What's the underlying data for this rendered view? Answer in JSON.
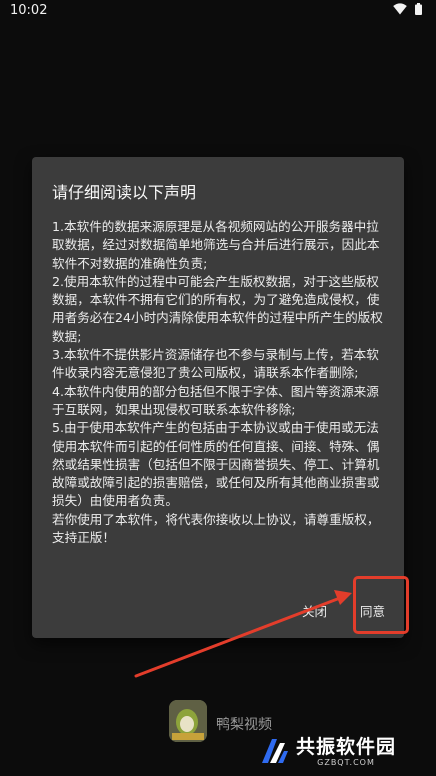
{
  "status_bar": {
    "time": "10:02"
  },
  "dialog": {
    "title": "请仔细阅读以下声明",
    "body": "1.本软件的数据来源原理是从各视频网站的公开服务器中拉取数据，经过对数据简单地筛选与合并后进行展示，因此本软件不对数据的准确性负责;\n2.使用本软件的过程中可能会产生版权数据，对于这些版权数据，本软件不拥有它们的所有权，为了避免造成侵权，使用者务必在24小时内清除使用本软件的过程中所产生的版权数据;\n3.本软件不提供影片资源储存也不参与录制与上传，若本软件收录内容无意侵犯了贵公司版权，请联系本作者删除;\n4.本软件内使用的部分包括但不限于字体、图片等资源来源于互联网，如果出现侵权可联系本软件移除;\n5.由于使用本软件产生的包括由于本协议或由于使用或无法使用本软件而引起的任何性质的任何直接、间接、特殊、偶然或结果性损害（包括但不限于因商誉损失、停工、计算机故障或故障引起的损害赔偿，或任何及所有其他商业损害或损失）由使用者负责。\n若你使用了本软件，将代表你接收以上协议，请尊重版权，支持正版！",
    "close_label": "关闭",
    "agree_label": "同意"
  },
  "app": {
    "name": "鸭梨视频"
  },
  "watermark": {
    "title": "共振软件园",
    "subtitle": "GZBQT.COM"
  },
  "colors": {
    "dialog_bg": "#3c3c3c",
    "highlight": "#e33d2b"
  }
}
